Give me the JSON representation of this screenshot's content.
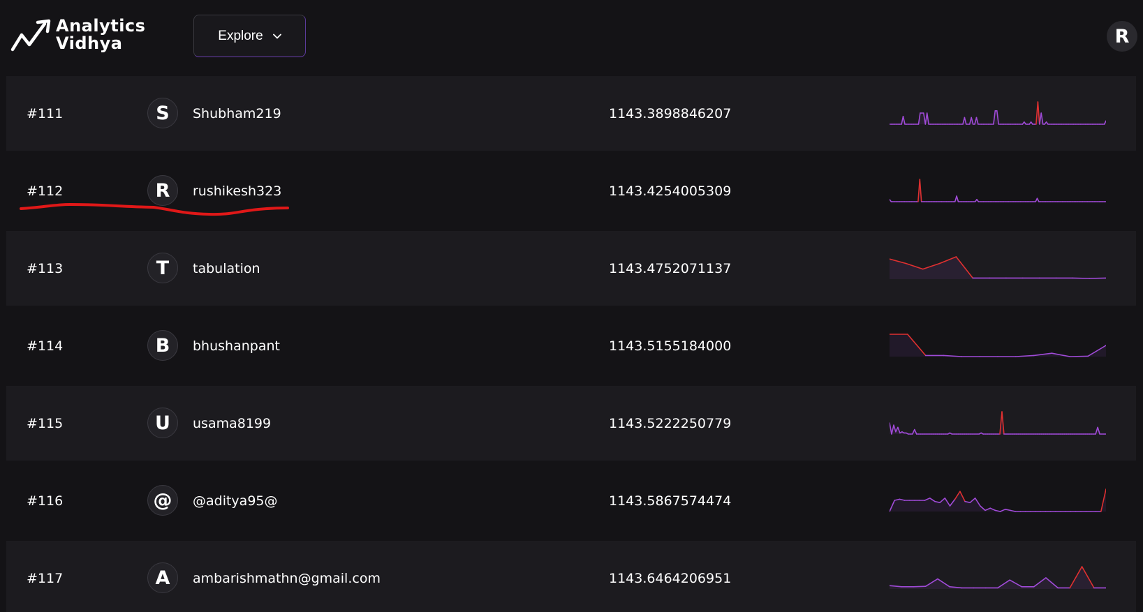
{
  "header": {
    "logo": {
      "icon": "trend-arrow-icon",
      "line1": "Analytics",
      "line2": "Vidhya"
    },
    "explore": {
      "label": "Explore",
      "icon": "chevron-down-icon"
    },
    "user_avatar_letter": "R"
  },
  "colors": {
    "background": "#141316",
    "row_alt": "#1c1b1f",
    "spark_purple": "#a04bd8",
    "spark_red": "#e03030",
    "annotation_red": "#e01818"
  },
  "leaderboard": {
    "rows": [
      {
        "rank": "#111",
        "initial": "S",
        "username": "Shubham219",
        "score": "1143.3898846207",
        "trend": [
          0,
          0,
          0,
          0,
          0,
          0,
          0,
          0,
          0.35,
          0,
          0,
          0,
          0,
          0,
          0,
          0,
          0,
          0,
          0.5,
          0.5,
          0.5,
          0,
          0.5,
          0,
          0,
          0,
          0,
          0,
          0,
          0,
          0,
          0,
          0,
          0,
          0,
          0,
          0,
          0,
          0,
          0,
          0,
          0,
          0,
          0,
          0.3,
          0,
          0,
          0,
          0.3,
          0,
          0,
          0.3,
          0,
          0,
          0,
          0,
          0,
          0,
          0,
          0,
          0,
          0,
          0.6,
          0.6,
          0,
          0,
          0,
          0,
          0,
          0,
          0,
          0,
          0,
          0,
          0,
          0,
          0,
          0,
          0,
          0.1,
          0,
          0,
          0,
          0.1,
          0,
          0,
          0,
          1,
          0,
          0.5,
          0,
          0,
          0.1,
          0,
          0,
          0,
          0,
          0,
          0,
          0,
          0,
          0,
          0,
          0,
          0,
          0,
          0,
          0,
          0,
          0,
          0,
          0,
          0,
          0,
          0,
          0,
          0,
          0,
          0,
          0,
          0,
          0,
          0,
          0,
          0,
          0,
          0,
          0.15
        ]
      },
      {
        "rank": "#112",
        "initial": "R",
        "username": "rushikesh323",
        "score": "1143.4254005309",
        "trend": [
          0.1,
          0,
          0,
          0,
          0,
          0,
          0,
          0,
          0,
          0,
          0,
          0,
          0,
          0,
          0,
          0,
          0,
          0,
          1,
          0,
          0,
          0,
          0,
          0,
          0,
          0,
          0,
          0,
          0,
          0,
          0,
          0,
          0,
          0,
          0,
          0,
          0,
          0,
          0,
          0,
          0.25,
          0,
          0,
          0,
          0,
          0,
          0,
          0,
          0,
          0,
          0,
          0,
          0.1,
          0,
          0,
          0,
          0,
          0,
          0,
          0,
          0,
          0,
          0,
          0,
          0,
          0,
          0,
          0,
          0,
          0,
          0,
          0,
          0,
          0,
          0,
          0,
          0,
          0,
          0,
          0,
          0,
          0,
          0,
          0,
          0,
          0,
          0,
          0,
          0.15,
          0,
          0,
          0,
          0,
          0,
          0,
          0,
          0,
          0,
          0,
          0,
          0,
          0,
          0,
          0,
          0,
          0,
          0,
          0,
          0,
          0,
          0,
          0,
          0,
          0,
          0,
          0,
          0,
          0,
          0,
          0,
          0,
          0,
          0,
          0,
          0,
          0,
          0,
          0,
          0,
          0
        ]
      },
      {
        "rank": "#113",
        "initial": "T",
        "username": "tabulation",
        "score": "1143.4752071137",
        "trend": [
          0.9,
          0.7,
          0.45,
          0.7,
          1,
          0.05,
          0.05,
          0.05,
          0.05,
          0.05,
          0.05,
          0.05,
          0.03,
          0.05
        ]
      },
      {
        "rank": "#114",
        "initial": "B",
        "username": "bhushanpant",
        "score": "1143.5155184000",
        "trend": [
          1,
          1,
          0.05,
          0.05,
          0,
          0,
          0,
          0,
          0.05,
          0.15,
          0,
          0.02,
          0.5
        ]
      },
      {
        "rank": "#115",
        "initial": "U",
        "username": "usama8199",
        "score": "1143.5222250779",
        "trend": [
          0.5,
          0,
          0.4,
          0.1,
          0.3,
          0.05,
          0.1,
          0.05,
          0.05,
          0,
          0,
          0,
          0.2,
          0,
          0,
          0,
          0,
          0,
          0,
          0,
          0,
          0,
          0,
          0,
          0,
          0,
          0,
          0,
          0,
          0.05,
          0,
          0,
          0,
          0,
          0,
          0,
          0,
          0,
          0,
          0,
          0,
          0,
          0,
          0,
          0.05,
          0,
          0,
          0,
          0,
          0,
          0,
          0,
          0,
          0,
          1,
          0,
          0,
          0,
          0,
          0,
          0,
          0,
          0,
          0,
          0,
          0,
          0,
          0,
          0,
          0,
          0,
          0,
          0,
          0,
          0,
          0,
          0,
          0,
          0,
          0,
          0,
          0,
          0,
          0,
          0,
          0,
          0,
          0,
          0,
          0,
          0,
          0,
          0,
          0,
          0,
          0,
          0,
          0,
          0,
          0,
          0.3,
          0,
          0,
          0,
          0
        ]
      },
      {
        "rank": "#116",
        "initial": "@",
        "username": "@aditya95@",
        "score": "1143.5867574474",
        "trend": [
          0,
          0.5,
          0.55,
          0.5,
          0.5,
          0.5,
          0.5,
          0.5,
          0.6,
          0.45,
          0.4,
          0.6,
          0.25,
          0.55,
          0.9,
          0.45,
          0.4,
          0.6,
          0.25,
          0.05,
          0.15,
          0.05,
          0,
          0.1,
          0.05,
          0,
          0,
          0,
          0,
          0,
          0,
          0,
          0,
          0,
          0,
          0,
          0,
          0,
          0,
          0,
          0,
          0,
          0,
          1
        ]
      },
      {
        "rank": "#117",
        "initial": "A",
        "username": "ambarishmathn@gmail.com",
        "score": "1143.6464206951",
        "trend": [
          0.15,
          0.1,
          0.1,
          0.12,
          0.45,
          0.1,
          0.05,
          0.05,
          0.05,
          0.05,
          0.4,
          0.1,
          0.1,
          0.5,
          0.05,
          0.05,
          1,
          0.05,
          0.05
        ]
      }
    ]
  }
}
